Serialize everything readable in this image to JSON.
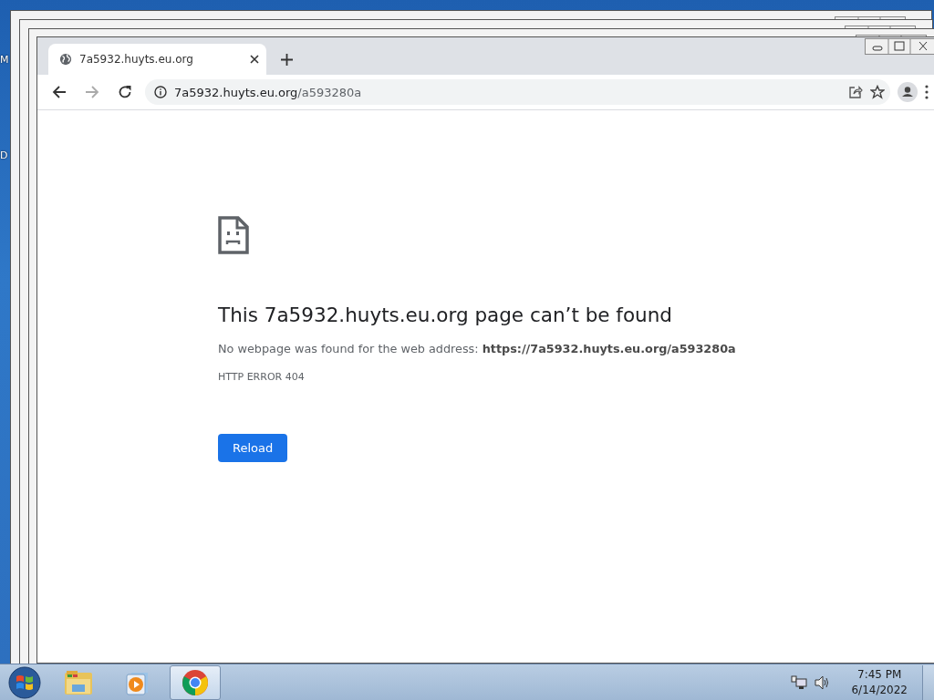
{
  "desktop": {
    "icon_labels": [
      "M",
      "D"
    ]
  },
  "browser": {
    "tab": {
      "title": "7a5932.huyts.eu.org",
      "selected": true
    },
    "address": {
      "host": "7a5932.huyts.eu.org",
      "path": "/a593280a"
    },
    "error_page": {
      "heading": "This 7a5932.huyts.eu.org page can’t be found",
      "message": "No webpage was found for the web address: **https://7a5932.huyts.eu.org/a593280a**",
      "code": "HTTP ERROR 404",
      "button": "Reload"
    }
  },
  "taskbar": {
    "apps": [
      {
        "kind": "explorer",
        "selected": false
      },
      {
        "kind": "media",
        "selected": false
      },
      {
        "kind": "chrome",
        "selected": true
      }
    ],
    "time": "7:45 PM",
    "date": "6/14/2022"
  }
}
